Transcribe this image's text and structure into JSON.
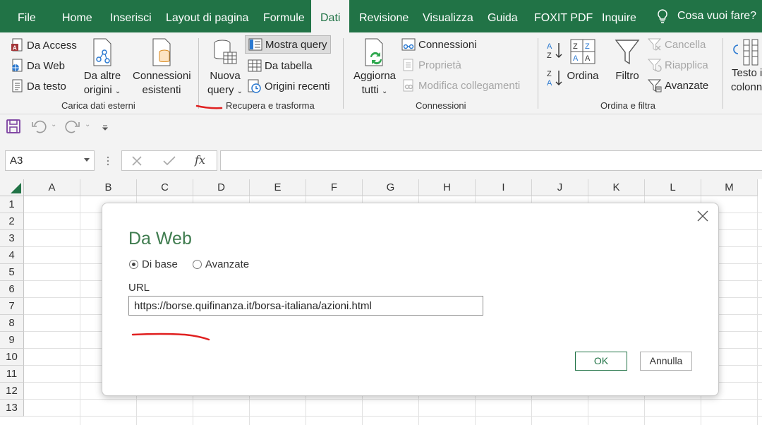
{
  "tabs": [
    "File",
    "Home",
    "Inserisci",
    "Layout di pagina",
    "Formule",
    "Dati",
    "Revisione",
    "Visualizza",
    "Guida",
    "FOXIT PDF",
    "Inquire"
  ],
  "active_tab": "Dati",
  "tell_me": "Cosa vuoi fare?",
  "ribbon": {
    "get_external": {
      "label": "Carica dati esterni",
      "from_access": "Da Access",
      "from_web": "Da Web",
      "from_text": "Da testo",
      "other_sources": [
        "Da altre",
        "origini"
      ],
      "existing_connections": [
        "Connessioni",
        "esistenti"
      ]
    },
    "get_transform": {
      "label": "Recupera e trasforma",
      "new_query": [
        "Nuova",
        "query"
      ],
      "show_queries": "Mostra query",
      "from_table": "Da tabella",
      "recent_sources": "Origini recenti"
    },
    "connections": {
      "label": "Connessioni",
      "refresh_all": [
        "Aggiorna",
        "tutti"
      ],
      "connections": "Connessioni",
      "properties": "Proprietà",
      "edit_links": "Modifica collegamenti"
    },
    "sort_filter": {
      "label": "Ordina e filtra",
      "sort": "Ordina",
      "filter": "Filtro",
      "clear": "Cancella",
      "reapply": "Riapplica",
      "advanced": "Avanzate"
    },
    "data_tools": {
      "text_to_columns": [
        "Testo in",
        "colonne"
      ]
    }
  },
  "name_box": "A3",
  "fx": "fx",
  "columns": [
    "A",
    "B",
    "C",
    "D",
    "E",
    "F",
    "G",
    "H",
    "I",
    "J",
    "K",
    "L",
    "M"
  ],
  "rows": [
    "1",
    "2",
    "3",
    "4",
    "5",
    "6",
    "7",
    "8",
    "9",
    "10",
    "11",
    "12",
    "13"
  ],
  "dialog": {
    "title": "Da Web",
    "basic_option": "Di base",
    "advanced_option": "Avanzate",
    "selected_option": "Di base",
    "url_label": "URL",
    "url_value": "https://borse.quifinanza.it/borsa-italiana/azioni.html",
    "ok": "OK",
    "cancel": "Annulla"
  },
  "colors": {
    "brand": "#217346",
    "dialog_title": "#3f7c4f",
    "annotation": "#e02020"
  }
}
